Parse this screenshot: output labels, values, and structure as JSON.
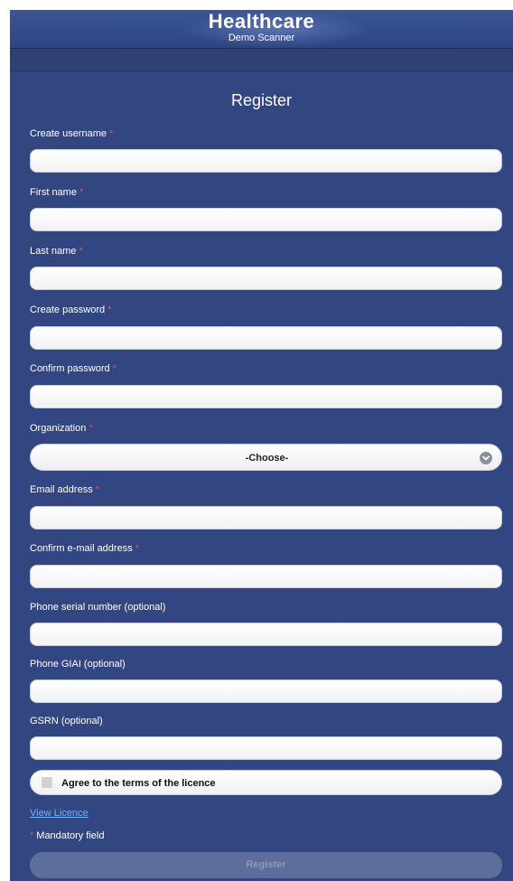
{
  "header": {
    "title": "Healthcare",
    "subtitle": "Demo Scanner"
  },
  "page": {
    "title": "Register"
  },
  "form": {
    "required_marker": "*",
    "fields": [
      {
        "label": "Create username",
        "required": true,
        "value": ""
      },
      {
        "label": "First name",
        "required": true,
        "value": ""
      },
      {
        "label": "Last name",
        "required": true,
        "value": ""
      },
      {
        "label": "Create password",
        "required": true,
        "value": ""
      },
      {
        "label": "Confirm password",
        "required": true,
        "value": ""
      },
      {
        "label": "Organization",
        "required": true,
        "selected": "-Choose-"
      },
      {
        "label": "Email address",
        "required": true,
        "value": ""
      },
      {
        "label": "Confirm e-mail address",
        "required": true,
        "value": ""
      },
      {
        "label": "Phone serial number (optional)",
        "required": false,
        "value": ""
      },
      {
        "label": "Phone GIAI (optional)",
        "required": false,
        "value": ""
      },
      {
        "label": "GSRN (optional)",
        "required": false,
        "value": ""
      }
    ],
    "terms": {
      "label": "Agree to the terms of the licence",
      "checked": false
    },
    "view_licence": "View Licence",
    "mandatory_note": "Mandatory field",
    "submit_label": "Register"
  },
  "colors": {
    "background": "#324781",
    "required": "#d9534f",
    "link": "#6bb1ff"
  },
  "icons": {
    "select_arrow": "chevron-down-circle-icon"
  }
}
